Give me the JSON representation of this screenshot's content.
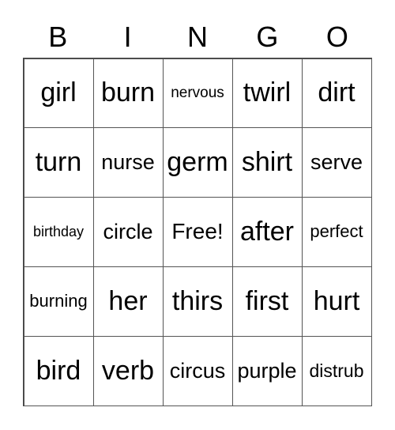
{
  "header": [
    "B",
    "I",
    "N",
    "G",
    "O"
  ],
  "cells": [
    [
      "girl",
      "burn",
      "nervous",
      "twirl",
      "dirt"
    ],
    [
      "turn",
      "nurse",
      "germ",
      "shirt",
      "serve"
    ],
    [
      "birthday",
      "circle",
      "Free!",
      "after",
      "perfect"
    ],
    [
      "burning",
      "her",
      "thirs",
      "first",
      "hurt"
    ],
    [
      "bird",
      "verb",
      "circus",
      "purple",
      "distrub"
    ]
  ]
}
